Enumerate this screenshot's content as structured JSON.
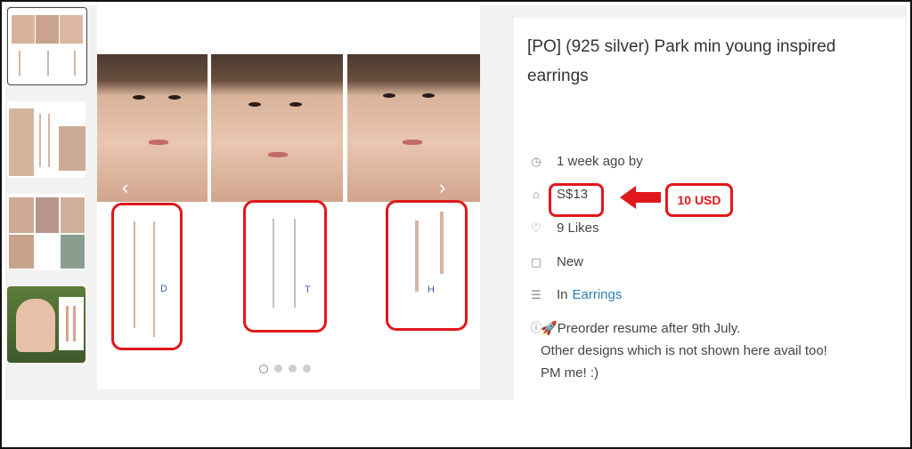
{
  "listing": {
    "title": "[PO] (925 silver) Park min young inspired earrings",
    "time_ago": "1 week ago by",
    "price": "S$13",
    "annotation_usd": "10 USD",
    "likes": "9 Likes",
    "condition": "New",
    "category_prefix": "In",
    "category": "Earrings",
    "description_line1": "Preorder resume after 9th July.",
    "description_line2": "Other designs which is not shown here avail too!",
    "description_line3": "PM me! :)"
  },
  "gallery": {
    "earring_labels": [
      "D",
      "T",
      "H"
    ],
    "dots": 4,
    "active_dot": 0
  },
  "icons": {
    "time": "clock-icon",
    "price": "tag-icon",
    "likes": "heart-icon",
    "condition": "box-icon",
    "category": "list-icon",
    "description": "info-icon"
  },
  "colors": {
    "annotation_red": "#e0181c",
    "link_blue": "#2a7fb8"
  }
}
